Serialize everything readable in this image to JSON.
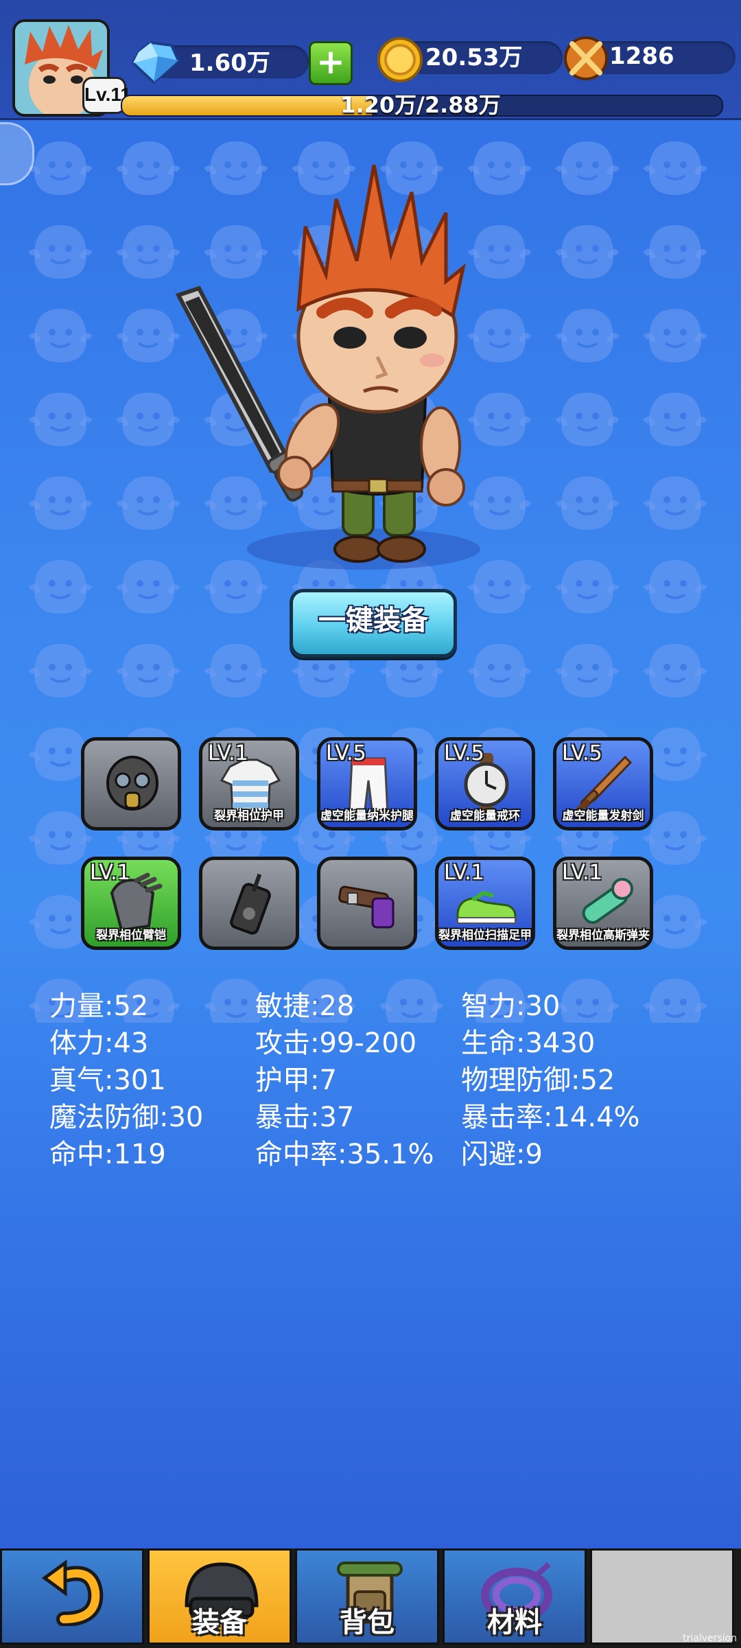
{
  "header": {
    "player_level": "Lv.11",
    "gems": "1.60万",
    "coins": "20.53万",
    "honor": "1286",
    "xp_text": "1.20万/2.88万",
    "xp_progress": 0.417
  },
  "main": {
    "equip_all_label": "一键装备"
  },
  "equipment": [
    {
      "level": "",
      "name": "",
      "icon": "gas-mask-helmet-icon",
      "color": "gray"
    },
    {
      "level": "LV.1",
      "name": "裂界相位护甲",
      "icon": "striped-shirt-icon",
      "color": "gray"
    },
    {
      "level": "LV.5",
      "name": "虚空能量纳米护腿",
      "icon": "white-pants-icon",
      "color": "blue"
    },
    {
      "level": "LV.5",
      "name": "虚空能量戒环",
      "icon": "wristwatch-icon",
      "color": "blue"
    },
    {
      "level": "LV.5",
      "name": "虚空能量发射剑",
      "icon": "wooden-sword-icon",
      "color": "blue"
    },
    {
      "level": "LV.1",
      "name": "裂界相位臂铠",
      "icon": "gauntlet-icon",
      "color": "green"
    },
    {
      "level": "",
      "name": "",
      "icon": "walkie-talkie-icon",
      "color": "gray"
    },
    {
      "level": "",
      "name": "",
      "icon": "belt-icon",
      "color": "gray"
    },
    {
      "level": "LV.1",
      "name": "裂界相位扫描足甲",
      "icon": "sneakers-icon",
      "color": "blue"
    },
    {
      "level": "LV.1",
      "name": "裂界相位高斯弹夹",
      "icon": "scope-icon",
      "color": "gray"
    }
  ],
  "stats": [
    [
      "力量:52",
      "敏捷:28",
      "智力:30"
    ],
    [
      "体力:43",
      "攻击:99-200",
      "生命:3430"
    ],
    [
      "真气:301",
      "护甲:7",
      "物理防御:52"
    ],
    [
      "魔法防御:30",
      "暴击:37",
      "暴击率:14.4%"
    ],
    [
      "命中:119",
      "命中率:35.1%",
      "闪避:9"
    ]
  ],
  "tabs": [
    {
      "label": "",
      "icon": "back-arrow-icon",
      "color": "blue"
    },
    {
      "label": "装备",
      "icon": "helmet-icon",
      "color": "orange"
    },
    {
      "label": "背包",
      "icon": "backpack-icon",
      "color": "blue"
    },
    {
      "label": "材料",
      "icon": "rope-coil-icon",
      "color": "blue"
    },
    {
      "label": "",
      "icon": "",
      "color": "gray"
    }
  ],
  "watermark": "trialversion"
}
